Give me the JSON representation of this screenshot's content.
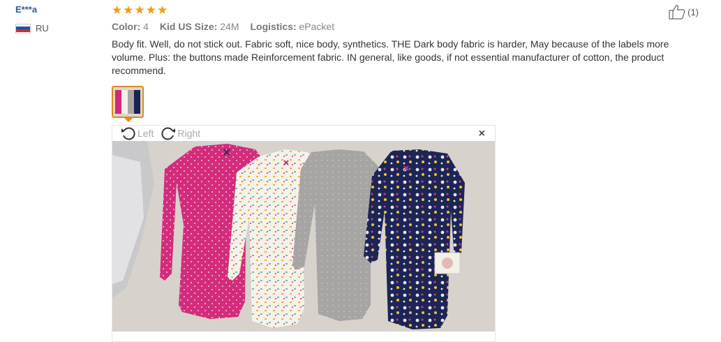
{
  "reviewer": {
    "name": "E***a",
    "country_code": "RU",
    "flag_colors": [
      "#ffffff",
      "#1f4fb0",
      "#d52b1e"
    ]
  },
  "review": {
    "rating": 5,
    "stars": [
      "★",
      "★",
      "★",
      "★",
      "★"
    ],
    "star_color": "#f09a1a",
    "attributes": [
      {
        "label": "Color:",
        "value": "4"
      },
      {
        "label": "Kid US Size:",
        "value": "24M"
      },
      {
        "label": "Logistics:",
        "value": "ePacket"
      }
    ],
    "text": "Body fit. Well, do not stick out. Fabric soft, nice body, synthetics. THE Dark body fabric is harder, May because of the labels more volume. Plus: the buttons made Reinforcement fabric. IN general, like goods, if not essential manufacturer of cotton, the product recommend."
  },
  "viewer": {
    "rotate_left_label": "Left",
    "rotate_right_label": "Right",
    "close_glyph": "×"
  },
  "helpful": {
    "count_label": "(1)"
  }
}
